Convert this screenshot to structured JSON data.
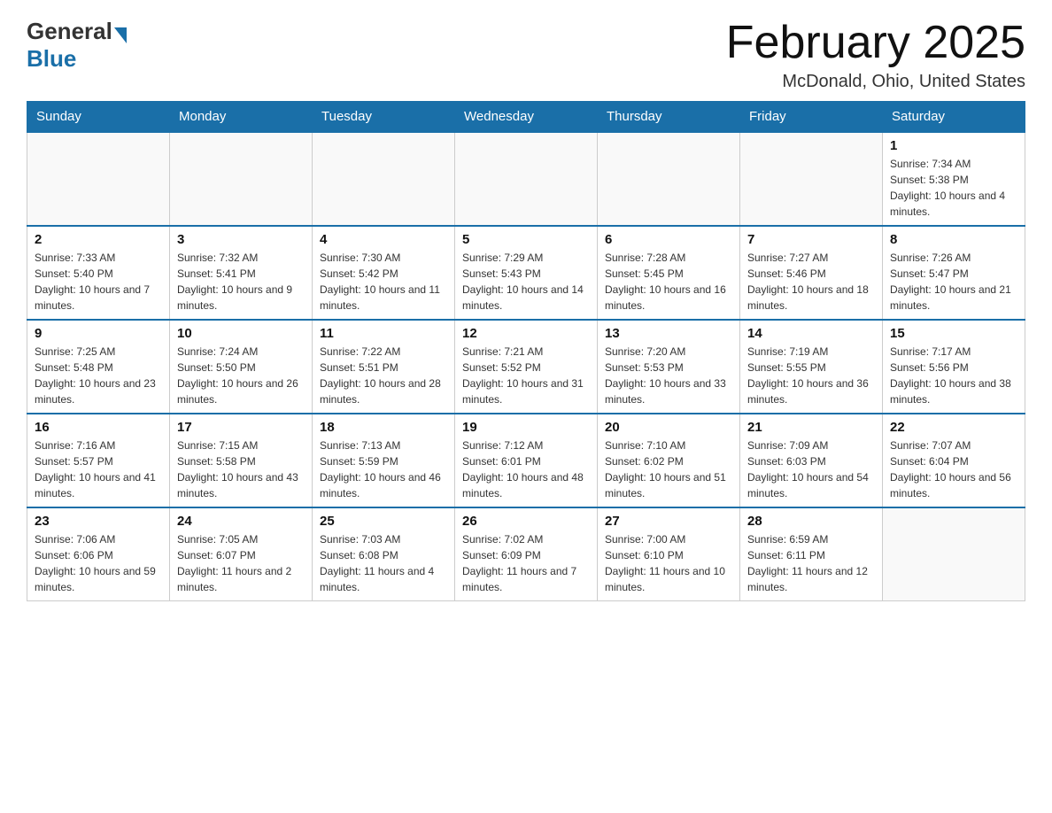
{
  "header": {
    "logo_general": "General",
    "logo_blue": "Blue",
    "title": "February 2025",
    "subtitle": "McDonald, Ohio, United States"
  },
  "days_of_week": [
    "Sunday",
    "Monday",
    "Tuesday",
    "Wednesday",
    "Thursday",
    "Friday",
    "Saturday"
  ],
  "weeks": [
    [
      {
        "day": "",
        "info": ""
      },
      {
        "day": "",
        "info": ""
      },
      {
        "day": "",
        "info": ""
      },
      {
        "day": "",
        "info": ""
      },
      {
        "day": "",
        "info": ""
      },
      {
        "day": "",
        "info": ""
      },
      {
        "day": "1",
        "info": "Sunrise: 7:34 AM\nSunset: 5:38 PM\nDaylight: 10 hours and 4 minutes."
      }
    ],
    [
      {
        "day": "2",
        "info": "Sunrise: 7:33 AM\nSunset: 5:40 PM\nDaylight: 10 hours and 7 minutes."
      },
      {
        "day": "3",
        "info": "Sunrise: 7:32 AM\nSunset: 5:41 PM\nDaylight: 10 hours and 9 minutes."
      },
      {
        "day": "4",
        "info": "Sunrise: 7:30 AM\nSunset: 5:42 PM\nDaylight: 10 hours and 11 minutes."
      },
      {
        "day": "5",
        "info": "Sunrise: 7:29 AM\nSunset: 5:43 PM\nDaylight: 10 hours and 14 minutes."
      },
      {
        "day": "6",
        "info": "Sunrise: 7:28 AM\nSunset: 5:45 PM\nDaylight: 10 hours and 16 minutes."
      },
      {
        "day": "7",
        "info": "Sunrise: 7:27 AM\nSunset: 5:46 PM\nDaylight: 10 hours and 18 minutes."
      },
      {
        "day": "8",
        "info": "Sunrise: 7:26 AM\nSunset: 5:47 PM\nDaylight: 10 hours and 21 minutes."
      }
    ],
    [
      {
        "day": "9",
        "info": "Sunrise: 7:25 AM\nSunset: 5:48 PM\nDaylight: 10 hours and 23 minutes."
      },
      {
        "day": "10",
        "info": "Sunrise: 7:24 AM\nSunset: 5:50 PM\nDaylight: 10 hours and 26 minutes."
      },
      {
        "day": "11",
        "info": "Sunrise: 7:22 AM\nSunset: 5:51 PM\nDaylight: 10 hours and 28 minutes."
      },
      {
        "day": "12",
        "info": "Sunrise: 7:21 AM\nSunset: 5:52 PM\nDaylight: 10 hours and 31 minutes."
      },
      {
        "day": "13",
        "info": "Sunrise: 7:20 AM\nSunset: 5:53 PM\nDaylight: 10 hours and 33 minutes."
      },
      {
        "day": "14",
        "info": "Sunrise: 7:19 AM\nSunset: 5:55 PM\nDaylight: 10 hours and 36 minutes."
      },
      {
        "day": "15",
        "info": "Sunrise: 7:17 AM\nSunset: 5:56 PM\nDaylight: 10 hours and 38 minutes."
      }
    ],
    [
      {
        "day": "16",
        "info": "Sunrise: 7:16 AM\nSunset: 5:57 PM\nDaylight: 10 hours and 41 minutes."
      },
      {
        "day": "17",
        "info": "Sunrise: 7:15 AM\nSunset: 5:58 PM\nDaylight: 10 hours and 43 minutes."
      },
      {
        "day": "18",
        "info": "Sunrise: 7:13 AM\nSunset: 5:59 PM\nDaylight: 10 hours and 46 minutes."
      },
      {
        "day": "19",
        "info": "Sunrise: 7:12 AM\nSunset: 6:01 PM\nDaylight: 10 hours and 48 minutes."
      },
      {
        "day": "20",
        "info": "Sunrise: 7:10 AM\nSunset: 6:02 PM\nDaylight: 10 hours and 51 minutes."
      },
      {
        "day": "21",
        "info": "Sunrise: 7:09 AM\nSunset: 6:03 PM\nDaylight: 10 hours and 54 minutes."
      },
      {
        "day": "22",
        "info": "Sunrise: 7:07 AM\nSunset: 6:04 PM\nDaylight: 10 hours and 56 minutes."
      }
    ],
    [
      {
        "day": "23",
        "info": "Sunrise: 7:06 AM\nSunset: 6:06 PM\nDaylight: 10 hours and 59 minutes."
      },
      {
        "day": "24",
        "info": "Sunrise: 7:05 AM\nSunset: 6:07 PM\nDaylight: 11 hours and 2 minutes."
      },
      {
        "day": "25",
        "info": "Sunrise: 7:03 AM\nSunset: 6:08 PM\nDaylight: 11 hours and 4 minutes."
      },
      {
        "day": "26",
        "info": "Sunrise: 7:02 AM\nSunset: 6:09 PM\nDaylight: 11 hours and 7 minutes."
      },
      {
        "day": "27",
        "info": "Sunrise: 7:00 AM\nSunset: 6:10 PM\nDaylight: 11 hours and 10 minutes."
      },
      {
        "day": "28",
        "info": "Sunrise: 6:59 AM\nSunset: 6:11 PM\nDaylight: 11 hours and 12 minutes."
      },
      {
        "day": "",
        "info": ""
      }
    ]
  ]
}
